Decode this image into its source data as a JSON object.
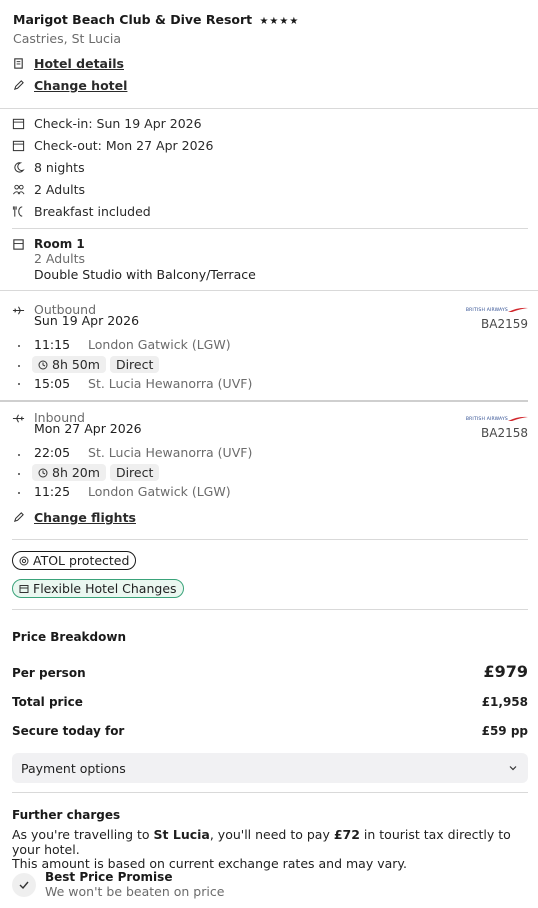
{
  "hotel": {
    "name": "Marigot Beach Club & Dive Resort",
    "stars": "★★★★",
    "location": "Castries, St Lucia",
    "details_link": "Hotel details",
    "change_link": "Change hotel"
  },
  "stay": {
    "checkin": "Check-in: Sun 19 Apr 2026",
    "checkout": "Check-out: Mon 27 Apr 2026",
    "nights": "8 nights",
    "guests": "2 Adults",
    "board": "Breakfast included"
  },
  "room": {
    "title": "Room 1",
    "guests": "2 Adults",
    "type": "Double Studio with Balcony/Terrace"
  },
  "flights": {
    "outbound": {
      "label": "Outbound",
      "date": "Sun 19 Apr 2026",
      "airline_logo_text": "BRITISH AIRWAYS",
      "code": "BA2159",
      "dep_time": "11:15",
      "dep_airport": "London Gatwick (LGW)",
      "duration": "8h 50m",
      "stops": "Direct",
      "arr_time": "15:05",
      "arr_airport": "St. Lucia Hewanorra (UVF)"
    },
    "inbound": {
      "label": "Inbound",
      "date": "Mon 27 Apr 2026",
      "airline_logo_text": "BRITISH AIRWAYS",
      "code": "BA2158",
      "dep_time": "22:05",
      "dep_airport": "St. Lucia Hewanorra (UVF)",
      "duration": "8h 20m",
      "stops": "Direct",
      "arr_time": "11:25",
      "arr_airport": "London Gatwick (LGW)"
    },
    "change_link": "Change flights"
  },
  "badges": {
    "atol": "ATOL protected",
    "flex": "Flexible Hotel Changes"
  },
  "price": {
    "heading": "Price Breakdown",
    "per_person_label": "Per person",
    "per_person_value": "£979",
    "total_label": "Total price",
    "total_value": "£1,958",
    "secure_label": "Secure today for",
    "secure_value": "£59 pp",
    "payment_options": "Payment options"
  },
  "further": {
    "heading": "Further charges",
    "text_1": "As you're travelling to ",
    "destination": "St Lucia",
    "text_2": ", you'll need to pay ",
    "amount": "£72",
    "text_3": " in tourist tax directly to your hotel.",
    "text_4": "This amount is based on current exchange rates and may vary."
  },
  "promise": {
    "title": "Best Price Promise",
    "subtitle": "We won't be beaten on price"
  },
  "colors": {
    "badge_flex_border": "#3aa37a",
    "badge_flex_bg": "#eaf7f0",
    "divider": "#d9d9d9"
  }
}
